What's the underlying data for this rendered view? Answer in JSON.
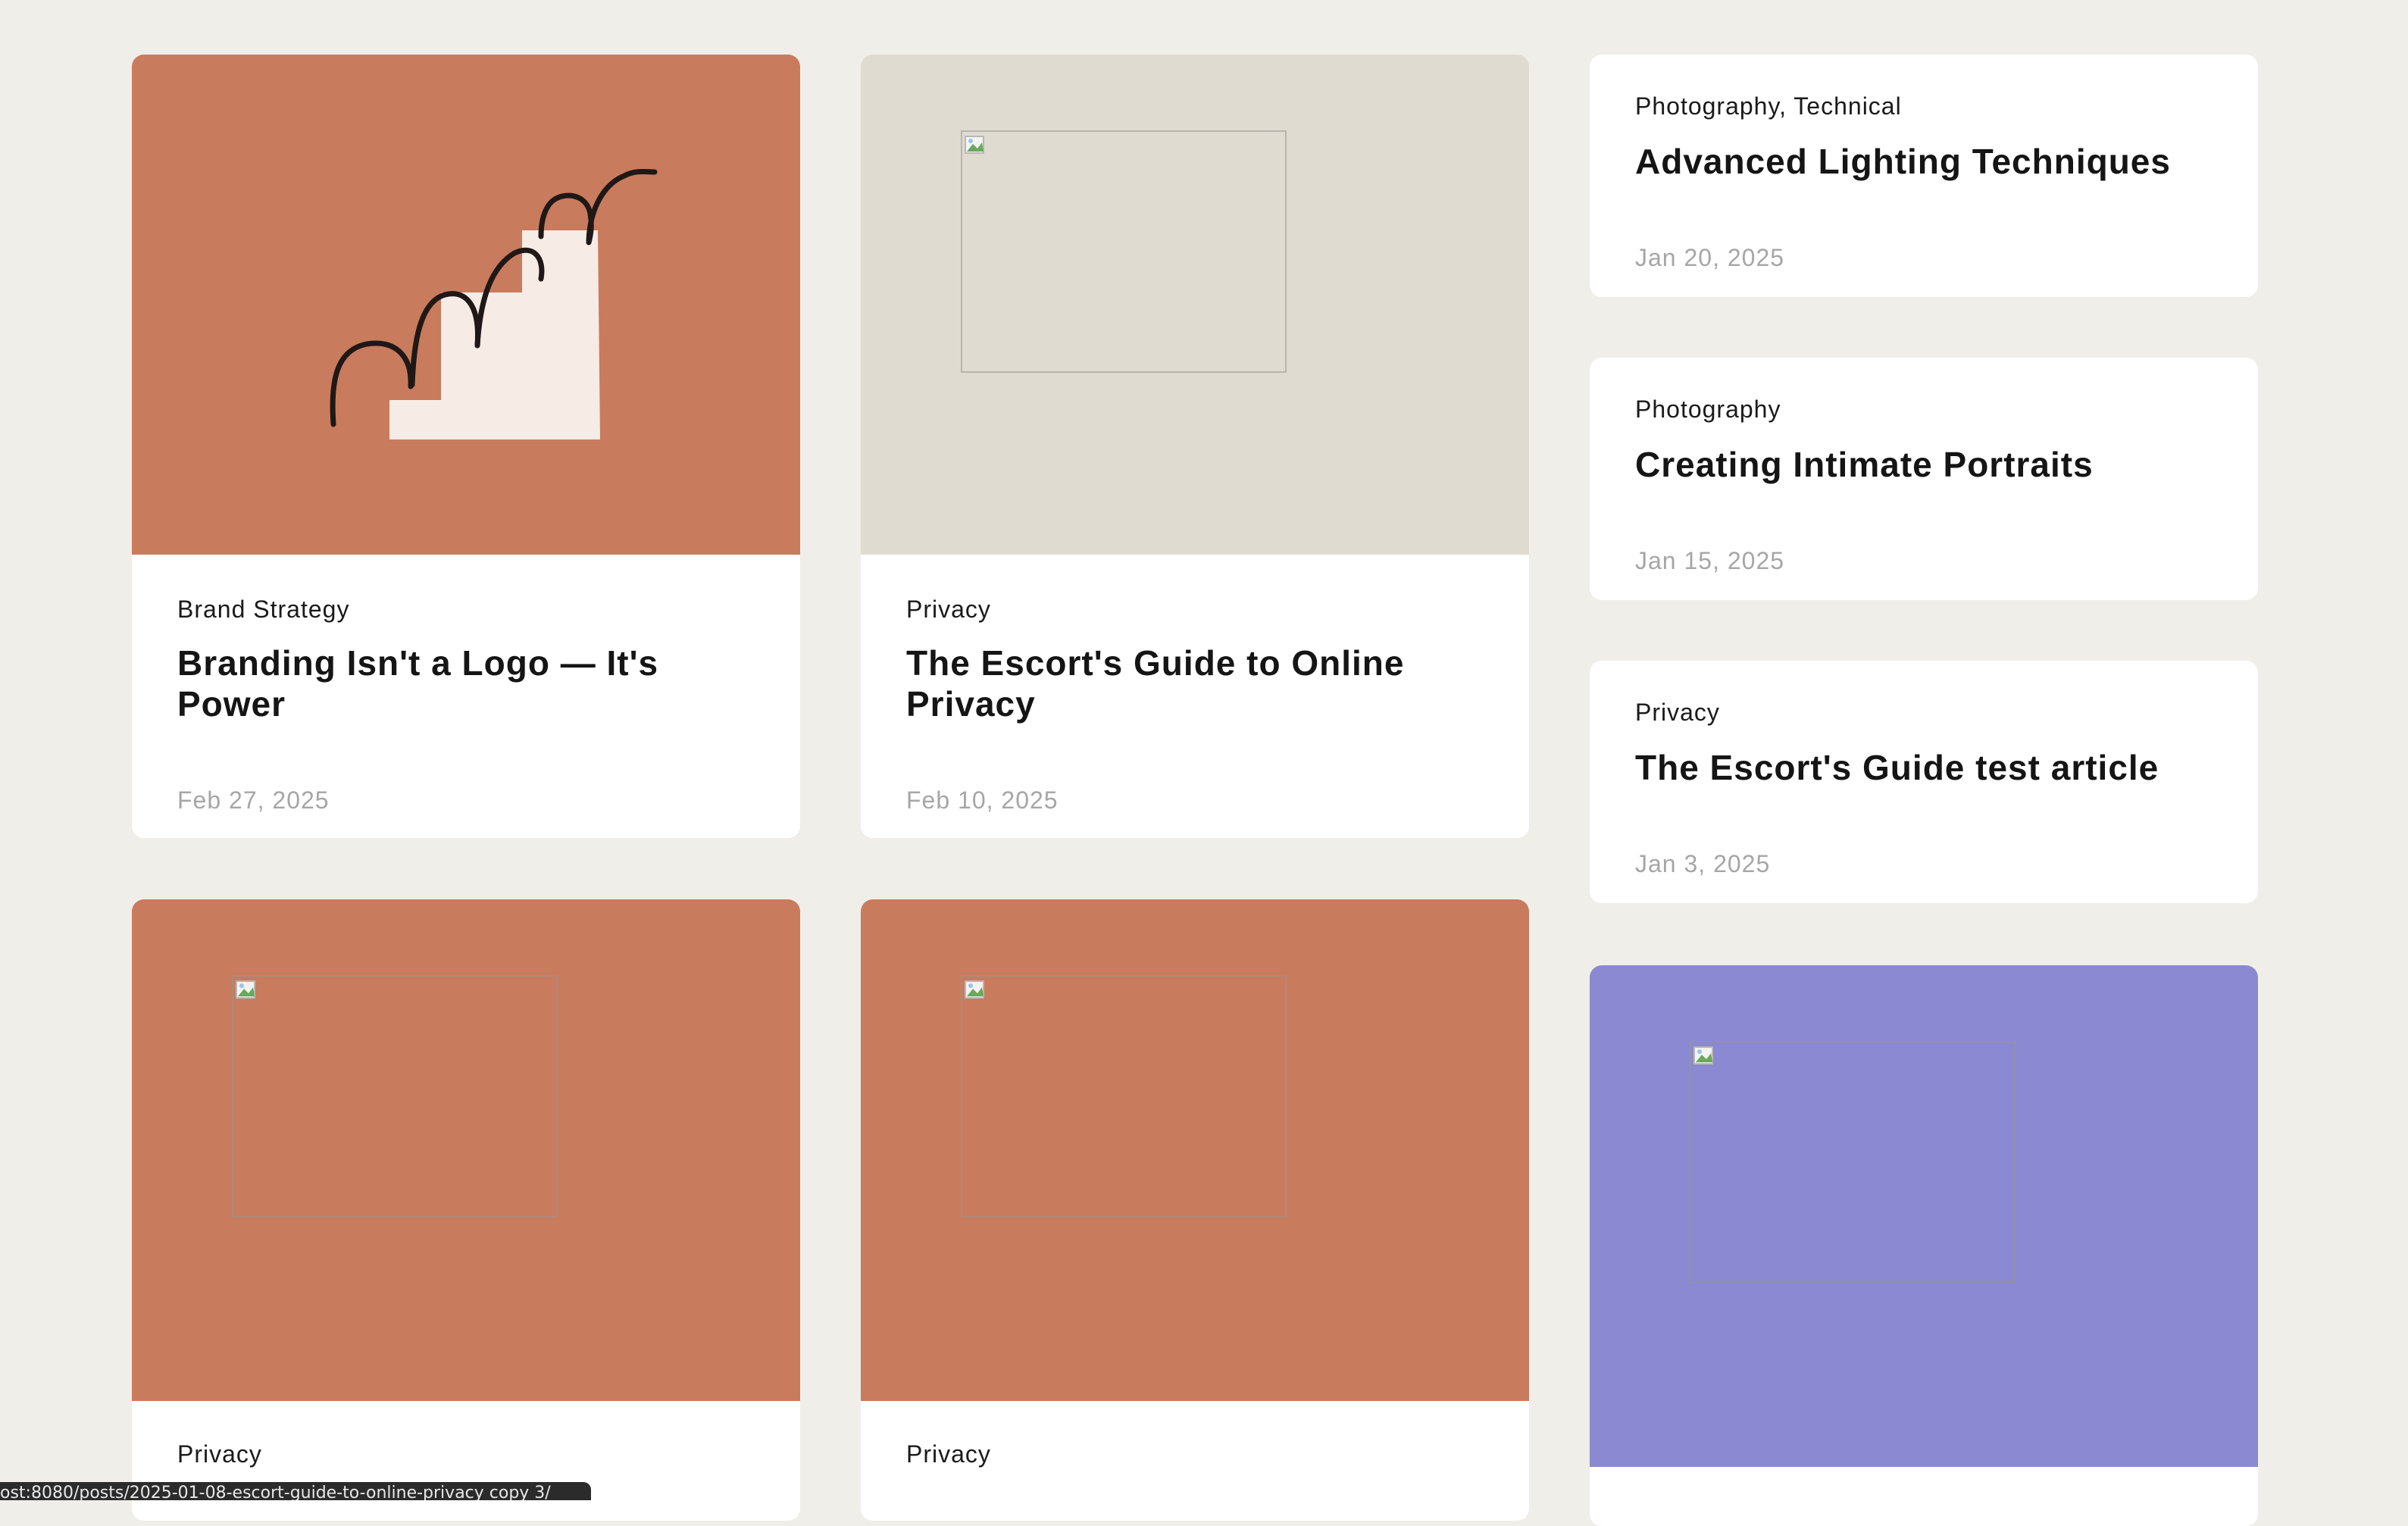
{
  "colors": {
    "page_bg": "#efeee9",
    "terracotta": "#c97b5d",
    "beige": "#e0dbd0",
    "lavender": "#8a89d1",
    "card_bg": "#ffffff"
  },
  "featured": [
    {
      "category": "Brand Strategy",
      "title": "Branding Isn't a Logo — It's Power",
      "date": "Feb 27, 2025",
      "media_color": "#c97b5d",
      "image": "stairs-illustration"
    },
    {
      "category": "Privacy",
      "title": "The Escort's Guide to Online Privacy",
      "date": "Feb 10, 2025",
      "media_color": "#e0dbd0",
      "image": "broken-image"
    }
  ],
  "side_posts": [
    {
      "category": "Photography, Technical",
      "title": "Advanced Lighting Techniques",
      "date": "Jan 20, 2025"
    },
    {
      "category": "Photography",
      "title": "Creating Intimate Portraits",
      "date": "Jan 15, 2025"
    },
    {
      "category": "Privacy",
      "title": "The Escort's Guide test article",
      "date": "Jan 3, 2025"
    }
  ],
  "lower_posts": [
    {
      "category": "Privacy",
      "media_color": "#c97b5d",
      "image": "broken-image"
    },
    {
      "category": "Privacy",
      "media_color": "#c97b5d",
      "image": "broken-image"
    },
    {
      "media_color": "#8a89d1",
      "image": "broken-image"
    }
  ],
  "status_bar": {
    "url": "ost:8080/posts/2025-01-08-escort-guide-to-online-privacy copy 3/"
  }
}
